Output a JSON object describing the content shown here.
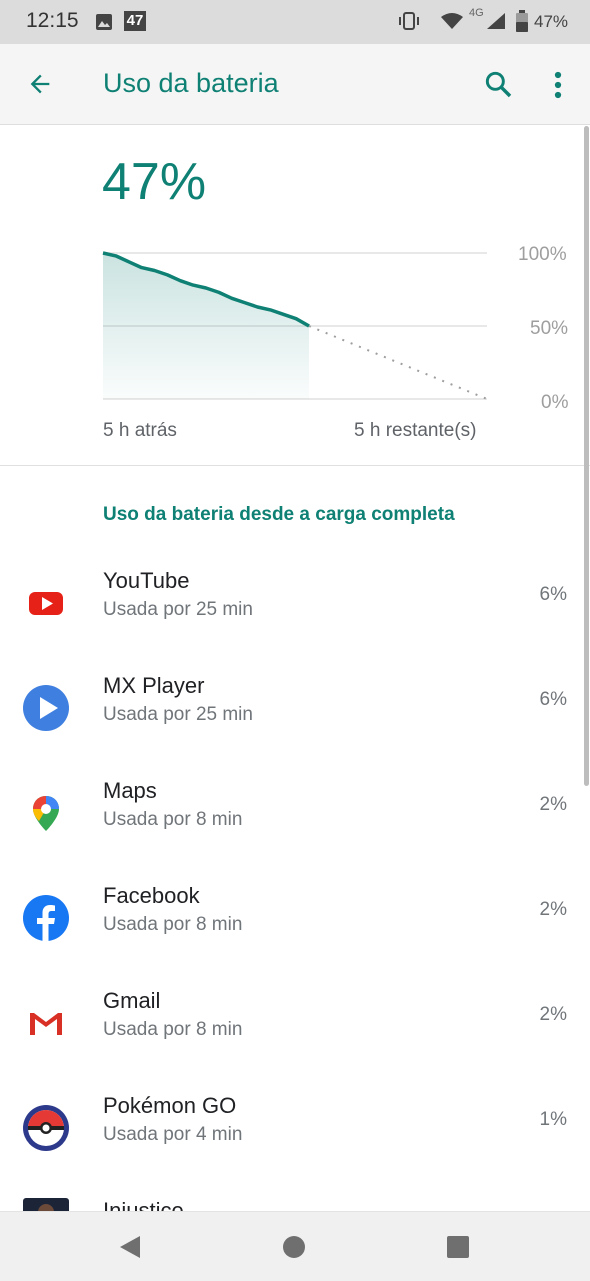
{
  "status_bar": {
    "time": "12:15",
    "notification_badge": "47",
    "network": "4G",
    "battery": "47%"
  },
  "app_bar": {
    "title": "Uso da bateria",
    "back_icon": "arrow-back-icon",
    "search_icon": "search-icon",
    "more_icon": "more-vert-icon"
  },
  "summary": {
    "level": "47%"
  },
  "chart_data": {
    "type": "line",
    "y_ticks": [
      "100%",
      "50%",
      "0%"
    ],
    "x_labels": [
      "5 h atrás",
      "5 h restante(s)"
    ],
    "ylim": [
      0,
      100
    ],
    "series": [
      {
        "values": [
          100,
          98,
          94,
          90,
          88,
          85,
          81,
          78,
          76,
          73,
          69,
          66,
          63,
          61,
          58,
          55,
          50
        ]
      }
    ],
    "projection": [
      50,
      0
    ],
    "accent": "#0f8074"
  },
  "section_title": "Uso da bateria desde a carga completa",
  "apps": [
    {
      "name": "YouTube",
      "usage": "Usada por 25 min",
      "percent": "6%",
      "icon": "youtube-icon"
    },
    {
      "name": "MX Player",
      "usage": "Usada por 25 min",
      "percent": "6%",
      "icon": "mx-player-icon"
    },
    {
      "name": "Maps",
      "usage": "Usada por 8 min",
      "percent": "2%",
      "icon": "maps-icon"
    },
    {
      "name": "Facebook",
      "usage": "Usada por 8 min",
      "percent": "2%",
      "icon": "facebook-icon"
    },
    {
      "name": "Gmail",
      "usage": "Usada por 8 min",
      "percent": "2%",
      "icon": "gmail-icon"
    },
    {
      "name": "Pokémon GO",
      "usage": "Usada por 4 min",
      "percent": "1%",
      "icon": "pokemon-go-icon"
    },
    {
      "name": "Injustice",
      "usage": "",
      "percent": "",
      "icon": "injustice-icon"
    }
  ]
}
